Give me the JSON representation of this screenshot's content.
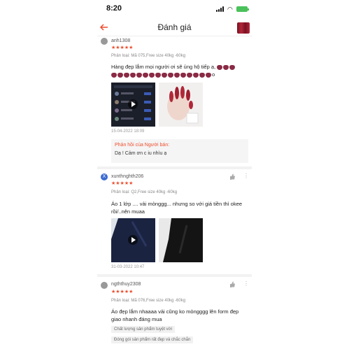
{
  "status_bar": {
    "time": "8:20"
  },
  "header": {
    "title": "Đánh giá",
    "back_icon": "back-arrow-icon"
  },
  "reviews": [
    {
      "username": "anh1308",
      "stars": "★★★★★",
      "variant": "Phân loại: Mã 075,Free size 40kg -60kg",
      "text_line1": "Hàng đẹp lắm mọi người ơi sẽ ủng hộ tiếp ạ,",
      "text_line2_suffix": "o",
      "date": "15-04-2022 18:09",
      "seller_reply_title": "Phản hồi của Người bán:",
      "seller_reply_text": "Dạ ! Cảm ơn c iu nhìu ạ"
    },
    {
      "username": "xunthnghth206",
      "avatar_letter": "X",
      "stars": "★★★★★",
      "variant": "Phân loại: Q2,Free size 40kg -60kg",
      "text_line1": "Áo 1 lớp .... vải mỏnggg... nhưng so với giá tiền thì okee",
      "text_line2": "rồi/..nên muaa",
      "date": "31-03-2022 10:47"
    },
    {
      "username": "ngththuy2308",
      "stars": "★★★★★",
      "variant": "Phân loại: Mã 076,Free size 40kg -60kg",
      "text_line1": "Áo đẹp lắm nhaaaa vải cũng ko mỏngggg lên form đẹp",
      "text_line2": "giao nhanh đáng mua",
      "tag1": "Chất lượng sản phẩm tuyệt vời",
      "tag2": "Đóng gói sản phẩm rất đẹp và chắc chắn"
    }
  ],
  "colors": {
    "accent": "#ee4d2d",
    "battery": "#4ac15a"
  }
}
